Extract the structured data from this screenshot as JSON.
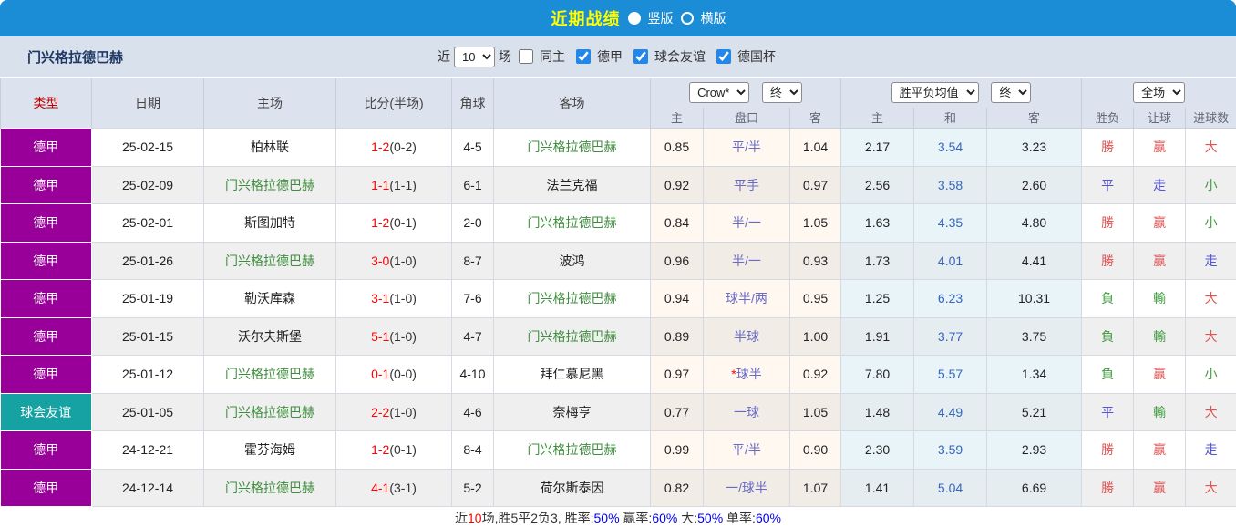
{
  "title_bar": {
    "title": "近期战绩",
    "vertical_label": "竖版",
    "horizontal_label": "横版"
  },
  "filter_bar": {
    "team_name": "门兴格拉德巴赫",
    "near_label": "近",
    "recent_count": "10",
    "matches_label": "场",
    "same_home_label": "同主",
    "same_home_checked": false,
    "filters": [
      {
        "label": "德甲",
        "checked": true
      },
      {
        "label": "球会友谊",
        "checked": true
      },
      {
        "label": "德国杯",
        "checked": true
      }
    ]
  },
  "controls": {
    "company_select": "Crow*",
    "asia_period_select": "终",
    "europe_select": "胜平负均值",
    "europe_period_select": "终",
    "scope_select": "全场"
  },
  "table": {
    "left_headers": [
      "类型",
      "日期",
      "主场",
      "比分(半场)",
      "角球",
      "客场"
    ],
    "sub_headers": [
      "主",
      "盘口",
      "客",
      "主",
      "和",
      "客",
      "胜负",
      "让球",
      "进球数"
    ],
    "rows": [
      {
        "type": "德甲",
        "type_class": "badge-purple",
        "date": "25-02-15",
        "home": "柏林联",
        "home_highlight": false,
        "score": "1-2",
        "half_score": "(0-2)",
        "corners": "4-5",
        "away": "门兴格拉德巴赫",
        "away_highlight": true,
        "asia_home": "0.85",
        "handicap_star": false,
        "handicap": "平/半",
        "asia_away": "1.04",
        "euro_home": "2.17",
        "euro_draw": "3.54",
        "euro_away": "3.23",
        "result": "勝",
        "result_class": "c-red",
        "handicap_result": "赢",
        "handicap_result_class": "c-red",
        "goals": "大",
        "goals_class": "c-red"
      },
      {
        "type": "德甲",
        "type_class": "badge-purple",
        "date": "25-02-09",
        "home": "门兴格拉德巴赫",
        "home_highlight": true,
        "score": "1-1",
        "half_score": "(1-1)",
        "corners": "6-1",
        "away": "法兰克福",
        "away_highlight": false,
        "asia_home": "0.92",
        "handicap_star": false,
        "handicap": "平手",
        "asia_away": "0.97",
        "euro_home": "2.56",
        "euro_draw": "3.58",
        "euro_away": "2.60",
        "result": "平",
        "result_class": "c-blue",
        "handicap_result": "走",
        "handicap_result_class": "c-blue",
        "goals": "小",
        "goals_class": "c-green"
      },
      {
        "type": "德甲",
        "type_class": "badge-purple",
        "date": "25-02-01",
        "home": "斯图加特",
        "home_highlight": false,
        "score": "1-2",
        "half_score": "(0-1)",
        "corners": "2-0",
        "away": "门兴格拉德巴赫",
        "away_highlight": true,
        "asia_home": "0.84",
        "handicap_star": false,
        "handicap": "半/一",
        "asia_away": "1.05",
        "euro_home": "1.63",
        "euro_draw": "4.35",
        "euro_away": "4.80",
        "result": "勝",
        "result_class": "c-red",
        "handicap_result": "赢",
        "handicap_result_class": "c-red",
        "goals": "小",
        "goals_class": "c-green"
      },
      {
        "type": "德甲",
        "type_class": "badge-purple",
        "date": "25-01-26",
        "home": "门兴格拉德巴赫",
        "home_highlight": true,
        "score": "3-0",
        "half_score": "(1-0)",
        "corners": "8-7",
        "away": "波鸿",
        "away_highlight": false,
        "asia_home": "0.96",
        "handicap_star": false,
        "handicap": "半/一",
        "asia_away": "0.93",
        "euro_home": "1.73",
        "euro_draw": "4.01",
        "euro_away": "4.41",
        "result": "勝",
        "result_class": "c-red",
        "handicap_result": "赢",
        "handicap_result_class": "c-red",
        "goals": "走",
        "goals_class": "c-blue"
      },
      {
        "type": "德甲",
        "type_class": "badge-purple",
        "date": "25-01-19",
        "home": "勒沃库森",
        "home_highlight": false,
        "score": "3-1",
        "half_score": "(1-0)",
        "corners": "7-6",
        "away": "门兴格拉德巴赫",
        "away_highlight": true,
        "asia_home": "0.94",
        "handicap_star": false,
        "handicap": "球半/两",
        "asia_away": "0.95",
        "euro_home": "1.25",
        "euro_draw": "6.23",
        "euro_away": "10.31",
        "result": "負",
        "result_class": "c-green",
        "handicap_result": "輸",
        "handicap_result_class": "c-green",
        "goals": "大",
        "goals_class": "c-red"
      },
      {
        "type": "德甲",
        "type_class": "badge-purple",
        "date": "25-01-15",
        "home": "沃尔夫斯堡",
        "home_highlight": false,
        "score": "5-1",
        "half_score": "(1-0)",
        "corners": "4-7",
        "away": "门兴格拉德巴赫",
        "away_highlight": true,
        "asia_home": "0.89",
        "handicap_star": false,
        "handicap": "半球",
        "asia_away": "1.00",
        "euro_home": "1.91",
        "euro_draw": "3.77",
        "euro_away": "3.75",
        "result": "負",
        "result_class": "c-green",
        "handicap_result": "輸",
        "handicap_result_class": "c-green",
        "goals": "大",
        "goals_class": "c-red"
      },
      {
        "type": "德甲",
        "type_class": "badge-purple",
        "date": "25-01-12",
        "home": "门兴格拉德巴赫",
        "home_highlight": true,
        "score": "0-1",
        "half_score": "(0-0)",
        "corners": "4-10",
        "away": "拜仁慕尼黑",
        "away_highlight": false,
        "asia_home": "0.97",
        "handicap_star": true,
        "handicap": "球半",
        "asia_away": "0.92",
        "euro_home": "7.80",
        "euro_draw": "5.57",
        "euro_away": "1.34",
        "result": "負",
        "result_class": "c-green",
        "handicap_result": "赢",
        "handicap_result_class": "c-red",
        "goals": "小",
        "goals_class": "c-green"
      },
      {
        "type": "球会友谊",
        "type_class": "badge-teal",
        "date": "25-01-05",
        "home": "门兴格拉德巴赫",
        "home_highlight": true,
        "score": "2-2",
        "half_score": "(1-0)",
        "corners": "4-6",
        "away": "奈梅亨",
        "away_highlight": false,
        "asia_home": "0.77",
        "handicap_star": false,
        "handicap": "一球",
        "asia_away": "1.05",
        "euro_home": "1.48",
        "euro_draw": "4.49",
        "euro_away": "5.21",
        "result": "平",
        "result_class": "c-blue",
        "handicap_result": "輸",
        "handicap_result_class": "c-green",
        "goals": "大",
        "goals_class": "c-red"
      },
      {
        "type": "德甲",
        "type_class": "badge-purple",
        "date": "24-12-21",
        "home": "霍芬海姆",
        "home_highlight": false,
        "score": "1-2",
        "half_score": "(0-1)",
        "corners": "8-4",
        "away": "门兴格拉德巴赫",
        "away_highlight": true,
        "asia_home": "0.99",
        "handicap_star": false,
        "handicap": "平/半",
        "asia_away": "0.90",
        "euro_home": "2.30",
        "euro_draw": "3.59",
        "euro_away": "2.93",
        "result": "勝",
        "result_class": "c-red",
        "handicap_result": "赢",
        "handicap_result_class": "c-red",
        "goals": "走",
        "goals_class": "c-blue"
      },
      {
        "type": "德甲",
        "type_class": "badge-purple",
        "date": "24-12-14",
        "home": "门兴格拉德巴赫",
        "home_highlight": true,
        "score": "4-1",
        "half_score": "(3-1)",
        "corners": "5-2",
        "away": "荷尔斯泰因",
        "away_highlight": false,
        "asia_home": "0.82",
        "handicap_star": false,
        "handicap": "一/球半",
        "asia_away": "1.07",
        "euro_home": "1.41",
        "euro_draw": "5.04",
        "euro_away": "6.69",
        "result": "勝",
        "result_class": "c-red",
        "handicap_result": "赢",
        "handicap_result_class": "c-red",
        "goals": "大",
        "goals_class": "c-red"
      }
    ]
  },
  "summary": {
    "segments": [
      {
        "text": "近",
        "color": "dark"
      },
      {
        "text": "10",
        "color": "red"
      },
      {
        "text": "场,胜5平2负3, 胜率:",
        "color": "dark"
      },
      {
        "text": "50%",
        "color": "blue"
      },
      {
        "text": " 赢率:",
        "color": "dark"
      },
      {
        "text": "60%",
        "color": "blue"
      },
      {
        "text": " 大:",
        "color": "dark"
      },
      {
        "text": "50%",
        "color": "blue"
      },
      {
        "text": " 单率:",
        "color": "dark"
      },
      {
        "text": "60%",
        "color": "blue"
      }
    ]
  },
  "colors": {
    "top_bar": "#1b8dd6",
    "title_text": "#ffff00",
    "league_badge": "#990099",
    "friendly_badge": "#16a2a2",
    "highlight_team": "#3e8e3e",
    "score_red": "#ff0000",
    "handicap_blue": "#6a6ac8",
    "draw_odds_blue": "#3565bd",
    "win_red": "#e05353",
    "lose_green": "#3f9c3f",
    "push_blue": "#5353dd",
    "checkbox_accent": "#2287e8"
  }
}
